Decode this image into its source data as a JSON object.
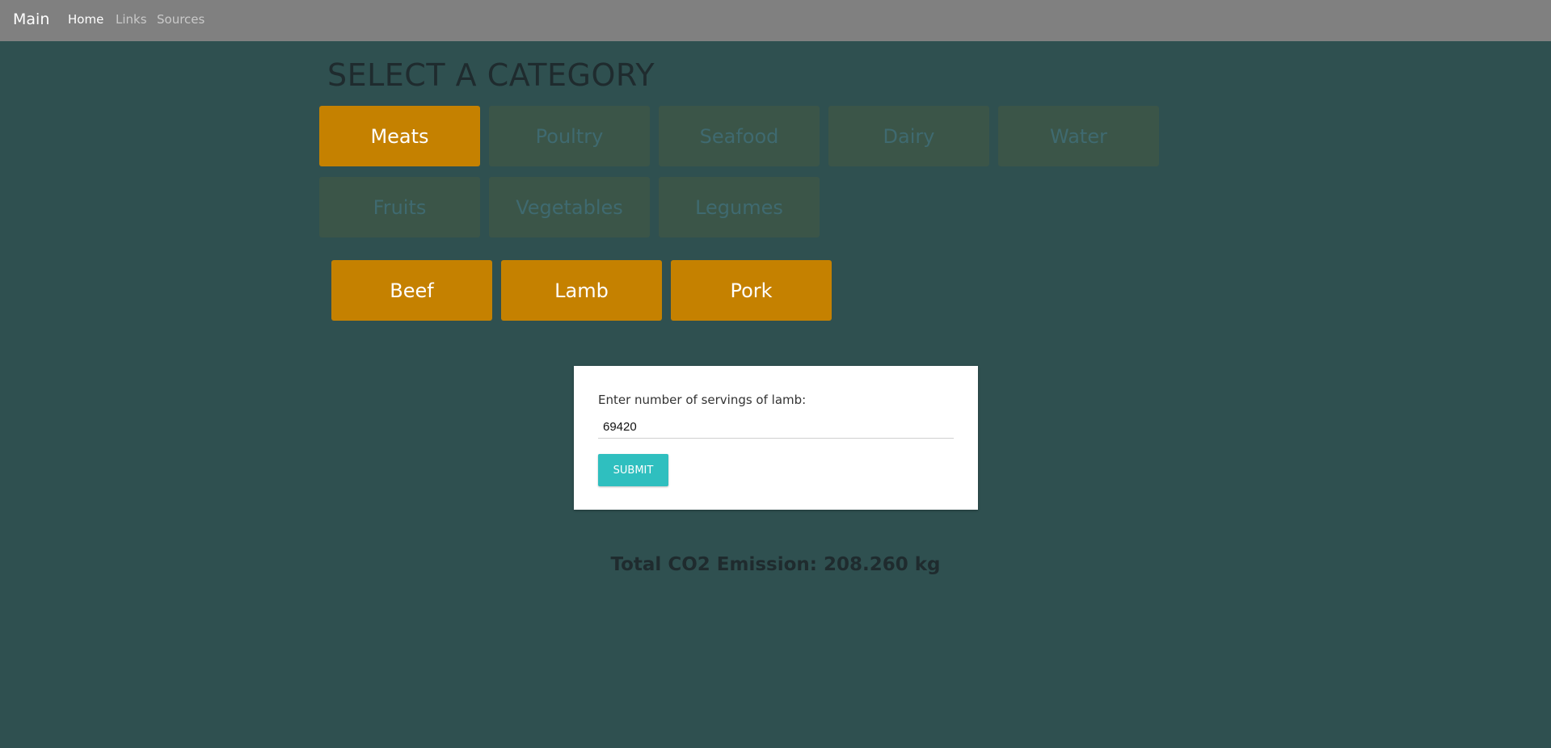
{
  "navbar": {
    "brand": "Main",
    "links": [
      "Home",
      "Links",
      "Sources"
    ]
  },
  "heading": "SELECT A CATEGORY",
  "categories": [
    "Meats",
    "Poultry",
    "Seafood",
    "Dairy",
    "Water",
    "Fruits",
    "Vegetables",
    "Legumes"
  ],
  "selected_category": "Meats",
  "subcategories": [
    "Beef",
    "Lamb",
    "Pork"
  ],
  "form": {
    "label": "Enter number of servings of lamb:",
    "value": "69420",
    "submit_label": "SUBMIT"
  },
  "result": "Total CO2 Emission: 208.260 kg",
  "colors": {
    "background": "#2f5050",
    "navbar": "#808080",
    "accent": "#c58100",
    "inactive_button": "#3b5548",
    "submit": "#2fbfbf"
  }
}
